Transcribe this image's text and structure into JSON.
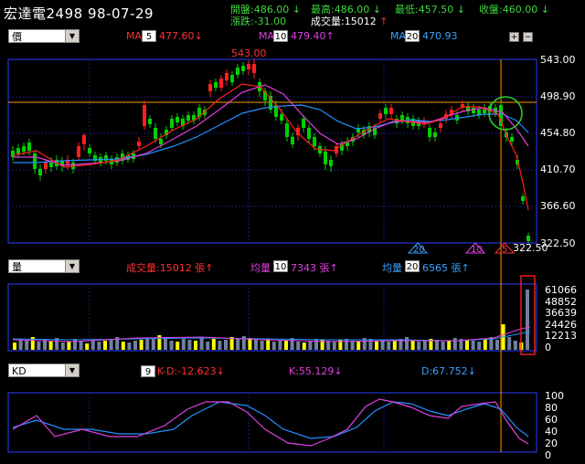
{
  "header": {
    "title": "宏達電2498  98-07-29",
    "open_label": "開盤:486.00",
    "high_label": "最高:486.00",
    "low_label": "最低:457.50",
    "close_label": "收盤:460.00",
    "change_label": "漲跌:-31.00",
    "volume_label": "成交量:15012"
  },
  "price_panel": {
    "selector": "價",
    "ma1_label": "MA",
    "ma1_period": "5",
    "ma1_value": "477.60",
    "ma2_label": "MA",
    "ma2_period": "10",
    "ma2_value": "479.40",
    "ma3_label": "MA",
    "ma3_period": "20",
    "ma3_value": "470.93",
    "peak_label": "543.00",
    "axis_labels": [
      "543.00",
      "498.90",
      "454.80",
      "410.70",
      "366.60",
      "322.50"
    ],
    "markers": [
      "20",
      "10",
      "5"
    ],
    "marker_value": "322.50",
    "colors": {
      "ma5": "#ff2020",
      "ma10": "#e040e0",
      "ma20": "#2090ff",
      "up": "#ff2020",
      "down": "#00d000"
    }
  },
  "volume_panel": {
    "selector": "量",
    "vol_label": "成交量:15012 張",
    "avg1_label": "均量",
    "avg1_period": "10",
    "avg1_value": "7343 張",
    "avg2_label": "均量",
    "avg2_period": "20",
    "avg2_value": "6565 張",
    "axis_labels": [
      "61066",
      "48852",
      "36639",
      "24426",
      "12213",
      "0"
    ]
  },
  "kd_panel": {
    "selector": "KD",
    "period": "9",
    "kd_diff_label": "K-D:-12.623",
    "k_label": "K:55.129",
    "d_label": "D:67.752",
    "axis_labels": [
      "100",
      "80",
      "60",
      "40",
      "20",
      "0"
    ]
  },
  "icons": {
    "arrow_down": "↓",
    "arrow_up": "↑",
    "zoom_in": "+",
    "zoom_out": "−"
  }
}
